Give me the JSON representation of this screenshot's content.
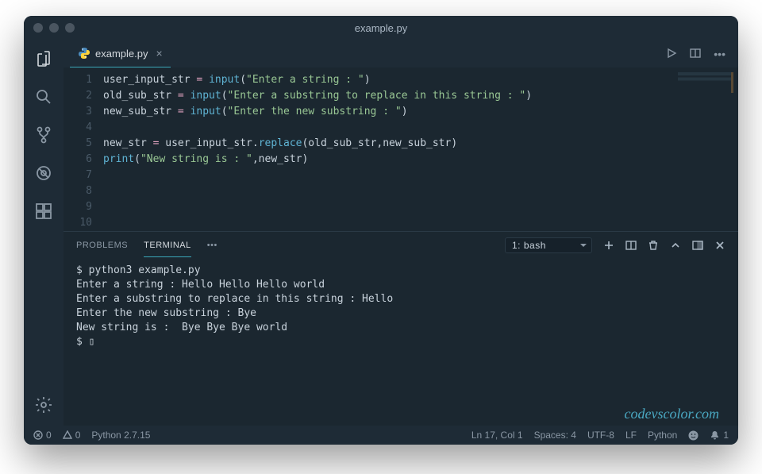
{
  "window": {
    "title": "example.py"
  },
  "tab": {
    "filename": "example.py"
  },
  "code": {
    "lines": [
      {
        "n": "1",
        "html": "<span class='tk-var'>user_input_str</span> <span class='tk-op'>=</span> <span class='tk-fn'>input</span>(<span class='tk-str'>\"Enter a string : \"</span>)"
      },
      {
        "n": "2",
        "html": "<span class='tk-var'>old_sub_str</span> <span class='tk-op'>=</span> <span class='tk-fn'>input</span>(<span class='tk-str'>\"Enter a substring to replace in this string : \"</span>)"
      },
      {
        "n": "3",
        "html": "<span class='tk-var'>new_sub_str</span> <span class='tk-op'>=</span> <span class='tk-fn'>input</span>(<span class='tk-str'>\"Enter the new substring : \"</span>)"
      },
      {
        "n": "4",
        "html": ""
      },
      {
        "n": "5",
        "html": "<span class='tk-var'>new_str</span> <span class='tk-op'>=</span> user_input_str.<span class='tk-method'>replace</span>(old_sub_str,new_sub_str)"
      },
      {
        "n": "6",
        "html": "<span class='tk-fn'>print</span>(<span class='tk-str'>\"New string is : \"</span>,new_str)"
      },
      {
        "n": "7",
        "html": ""
      },
      {
        "n": "8",
        "html": ""
      },
      {
        "n": "9",
        "html": ""
      },
      {
        "n": "10",
        "html": ""
      }
    ]
  },
  "panel": {
    "tabs": {
      "problems": "PROBLEMS",
      "terminal": "TERMINAL"
    },
    "terminal_select": "1: bash",
    "output": "$ python3 example.py\nEnter a string : Hello Hello Hello world\nEnter a substring to replace in this string : Hello\nEnter the new substring : Bye\nNew string is :  Bye Bye Bye world\n$ ▯"
  },
  "status": {
    "errors": "0",
    "warnings": "0",
    "python_version": "Python 2.7.15",
    "position": "Ln 17, Col 1",
    "spaces": "Spaces: 4",
    "encoding": "UTF-8",
    "eol": "LF",
    "language": "Python",
    "notifications": "1"
  },
  "watermark": "codevscolor.com"
}
